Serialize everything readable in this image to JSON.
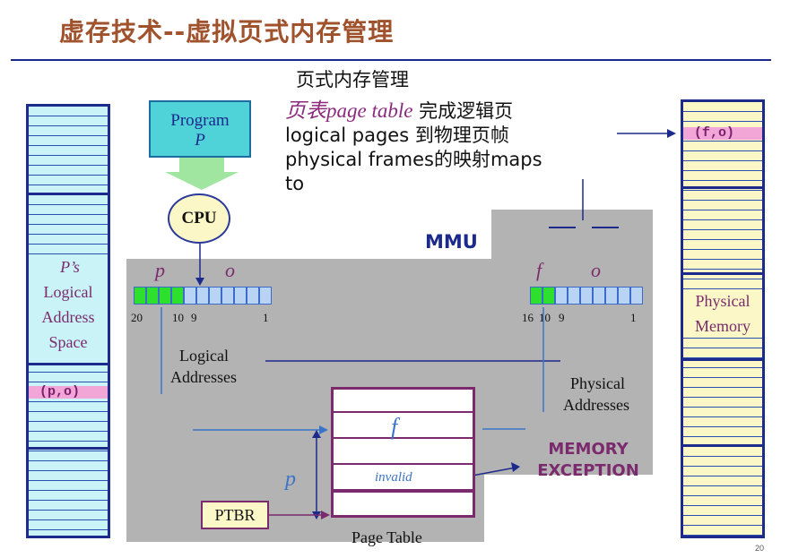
{
  "title": "虚存技术--虚拟页式内存管理",
  "description": {
    "line1": "页式内存管理",
    "line2_em": "页表page table",
    "line2_rest": " 完成逻辑页",
    "line3": "logical pages 到物理页帧",
    "line4": "physical frames的映射maps",
    "line5": "to"
  },
  "program": {
    "label": "Program",
    "var": "P"
  },
  "cpu_label": "CPU",
  "mmu_label": "MMU",
  "logical_space": {
    "line1": "P’s",
    "line2": "Logical",
    "line3": "Address",
    "line4": "Space",
    "entry": "(p,o)"
  },
  "physical_memory": {
    "line1": "Physical",
    "line2": "Memory",
    "entry": "(f,o)"
  },
  "logical_addr": {
    "p": "p",
    "o": "o",
    "b20": "20",
    "b10": "10",
    "b9": "9",
    "b1": "1",
    "label1": "Logical",
    "label2": "Addresses"
  },
  "physical_addr": {
    "f": "f",
    "o": "o",
    "b16": "16",
    "b10": "10",
    "b9": "9",
    "b1": "1",
    "label1": "Physical",
    "label2": "Addresses"
  },
  "page_table": {
    "f_entry": "f",
    "invalid_entry": "invalid",
    "label": "Page Table",
    "p_index": "p"
  },
  "ptbr_label": "PTBR",
  "exception": {
    "line1": "MEMORY",
    "line2": "EXCEPTION"
  },
  "page_number": "20",
  "colors": {
    "title": "#a0522d",
    "border": "#1c2a8c",
    "mmu_gray": "#b3b3b3",
    "accent_purple": "#7b2a6e",
    "highlight_pink": "#f2a6d8"
  }
}
